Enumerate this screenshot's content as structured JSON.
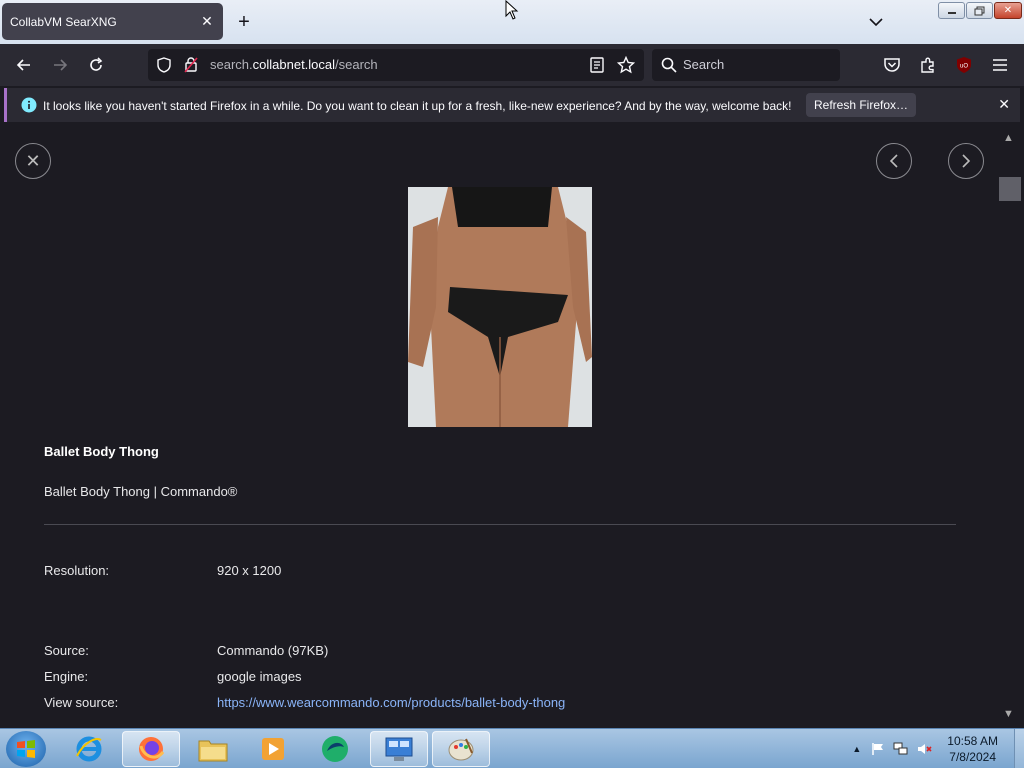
{
  "browser": {
    "tab_title": "CollabVM SearXNG",
    "url_scheme_prefix": "search.",
    "url_host": "collabnet.local",
    "url_path": "/search",
    "search_placeholder": "Search"
  },
  "notification": {
    "message": "It looks like you haven't started Firefox in a while. Do you want to clean it up for a fresh, like-new experience? And by the way, welcome back!",
    "button_label": "Refresh Firefox…"
  },
  "result": {
    "title": "Ballet Body Thong",
    "description": "Ballet Body Thong | Commando®",
    "details": [
      {
        "label": "Resolution:",
        "value": "920 x 1200"
      },
      {
        "label": "Source:",
        "value": "Commando (97KB)"
      },
      {
        "label": "Engine:",
        "value": "google images"
      },
      {
        "label": "View source:",
        "value": "https://www.wearcommando.com/products/ballet-body-thong"
      }
    ]
  },
  "taskbar": {
    "time": "10:58 AM",
    "date": "7/8/2024"
  },
  "colors": {
    "page_bg": "#1c1b22",
    "toolbar_bg": "#2b2a33",
    "link": "#8ab4f8",
    "accent_notification": "#a872c9"
  }
}
